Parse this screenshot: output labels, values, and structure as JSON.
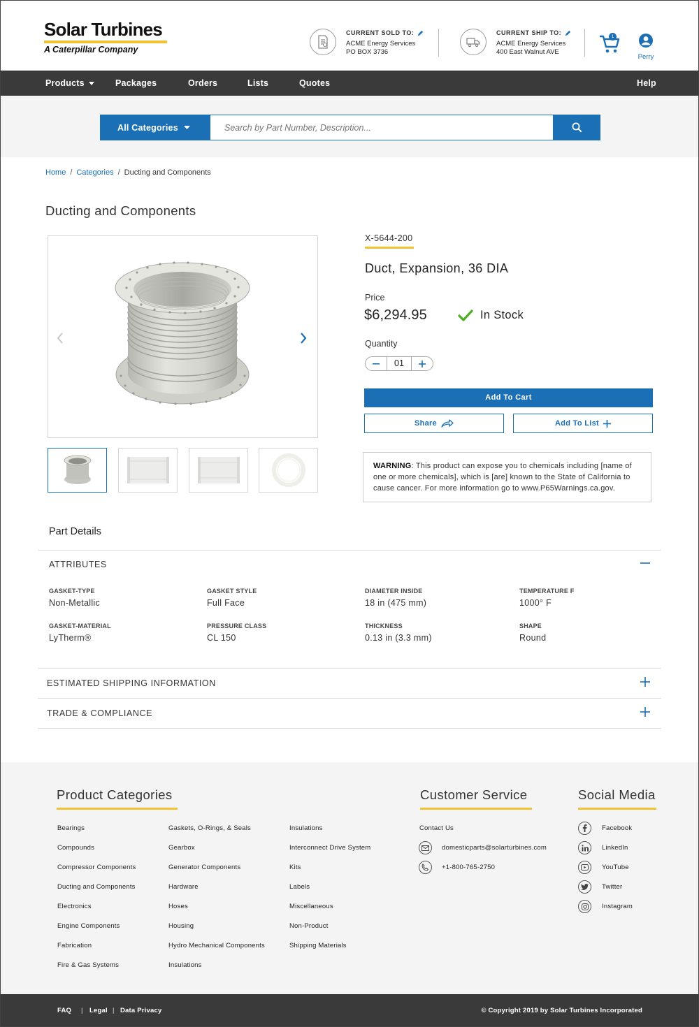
{
  "brand": {
    "name": "Solar Turbines",
    "tagline": "A Caterpillar Company",
    "accent_color": "#f2c230",
    "primary_color": "#1a6fb5"
  },
  "header": {
    "sold_to": {
      "label": "CURRENT SOLD TO:",
      "name": "ACME Energy Services",
      "line": "PO BOX 3736"
    },
    "ship_to": {
      "label": "CURRENT SHIP TO:",
      "name": "ACME Energy Services",
      "line": "400 East Walnut AVE"
    },
    "cart_count": "1",
    "user_name": "Perry"
  },
  "nav": {
    "items": [
      "Products",
      "Packages",
      "Orders",
      "Lists",
      "Quotes"
    ],
    "help": "Help"
  },
  "search": {
    "category_label": "All Categories",
    "placeholder": "Search by Part Number, Description..."
  },
  "breadcrumb": [
    "Home",
    "Categories",
    "Ducting and Components"
  ],
  "page_title": "Ducting and Components",
  "product": {
    "part_number": "X-5644-200",
    "name": "Duct, Expansion, 36 DIA",
    "price_label": "Price",
    "price": "$6,294.95",
    "stock_status": "In Stock",
    "quantity_label": "Quantity",
    "quantity": "01",
    "add_to_cart": "Add To Cart",
    "share": "Share",
    "add_to_list": "Add To List",
    "warning_label": "WARNING",
    "warning_text": ": This product can expose you to chemicals including [name of one or more chemicals], which is [are] known to the State of California to cause cancer.  For more information go to www.P65Warnings.ca.gov."
  },
  "details": {
    "title": "Part Details",
    "attributes_title": "ATTRIBUTES",
    "attributes": [
      {
        "label": "GASKET-TYPE",
        "value": "Non-Metallic"
      },
      {
        "label": "GASKET STYLE",
        "value": "Full Face"
      },
      {
        "label": "DIAMETER INSIDE",
        "value": "18 in (475 mm)"
      },
      {
        "label": "TEMPERATURE F",
        "value": "1000° F"
      },
      {
        "label": "GASKET-MATERIAL",
        "value": "LyTherm®"
      },
      {
        "label": "PRESSURE CLASS",
        "value": "CL 150"
      },
      {
        "label": "THICKNESS",
        "value": "0.13 in (3.3 mm)"
      },
      {
        "label": "SHAPE",
        "value": "Round"
      }
    ],
    "shipping_title": "ESTIMATED SHIPPING INFORMATION",
    "trade_title": "TRADE & COMPLIANCE"
  },
  "footer": {
    "categories_heading": "Product Categories",
    "categories": [
      "Bearings",
      "Compounds",
      "Compressor Components",
      "Ducting and Components",
      "Electronics",
      "Engine Components",
      "Fabrication",
      "Fire & Gas Systems",
      "Gaskets, O-Rings, & Seals",
      "Gearbox",
      "Generator Components",
      "Hardware",
      "Hoses",
      "Housing",
      "Hydro Mechanical Components",
      "Insulations",
      "Insulations",
      "Interconnect Drive System",
      "Kits",
      "Labels",
      "Miscellaneous",
      "Non-Product",
      "Shipping Materials"
    ],
    "service_heading": "Customer Service",
    "contact_us": "Contact Us",
    "email": "domesticparts@solarturbines.com",
    "phone": "+1-800-765-2750",
    "social_heading": "Social Media",
    "social": [
      "Facebook",
      "LinkedIn",
      "YouTube",
      "Twitter",
      "Instagram"
    ]
  },
  "bottom_bar": {
    "links": [
      "FAQ",
      "Legal",
      "Data Privacy"
    ],
    "copyright": "© Copyright 2019 by Solar Turbines Incorporated"
  }
}
